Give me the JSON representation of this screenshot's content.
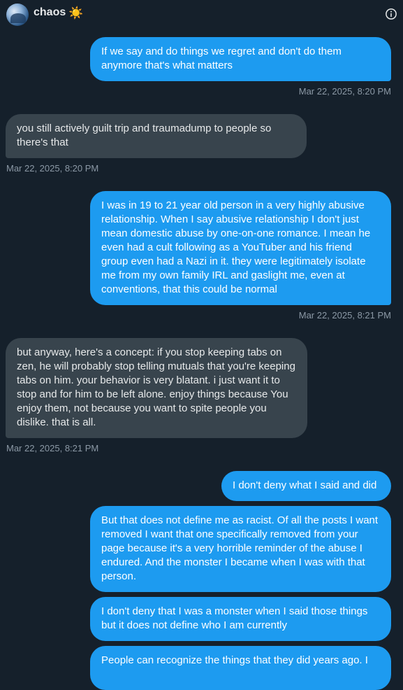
{
  "header": {
    "name": "chaos",
    "emoji": "☀️",
    "avatar_icon": "profile-picture",
    "info_icon": "info-icon"
  },
  "colors": {
    "background": "#15202b",
    "outgoing_bubble": "#1d9bf0",
    "incoming_bubble": "#38444d",
    "timestamp": "#8b98a5"
  },
  "messages": [
    {
      "direction": "outgoing",
      "text": "If we say and do things we regret and don't do them anymore that's what matters",
      "timestamp": "Mar 22, 2025, 8:20 PM"
    },
    {
      "direction": "incoming",
      "text": "you still actively guilt trip and traumadump to people so there's that",
      "timestamp": "Mar 22, 2025, 8:20 PM"
    },
    {
      "direction": "outgoing",
      "text": "I was in 19 to 21 year old person in a very highly abusive relationship. When I say abusive relationship I don't just mean domestic abuse by one-on-one romance. I mean he even had a cult following as a YouTuber and his friend group even had a Nazi in it.  they were legitimately isolate me from my own family IRL and gaslight me, even at conventions, that this could be normal",
      "timestamp": "Mar 22, 2025, 8:21 PM"
    },
    {
      "direction": "incoming",
      "text": "but anyway, here's a concept: if you stop keeping tabs on zen, he will probably stop telling mutuals that you're keeping tabs on him. your behavior is very blatant. i just want it to stop and for him to be left alone. enjoy things because You enjoy them, not because you want to spite people you dislike. that is all.",
      "timestamp": "Mar 22, 2025, 8:21 PM"
    },
    {
      "direction": "outgoing",
      "text": "I don't deny what I said and did"
    },
    {
      "direction": "outgoing",
      "text": "But that does not define me as racist. Of all the posts I want removed I want that one specifically removed from your page because it's a very horrible reminder of the abuse I endured. And the monster I became when I was with that person."
    },
    {
      "direction": "outgoing",
      "text": "I don't deny that I was a monster when I said those things but it does not define who I am currently"
    },
    {
      "direction": "outgoing",
      "text": "People can recognize the things that they did years ago. I"
    }
  ]
}
